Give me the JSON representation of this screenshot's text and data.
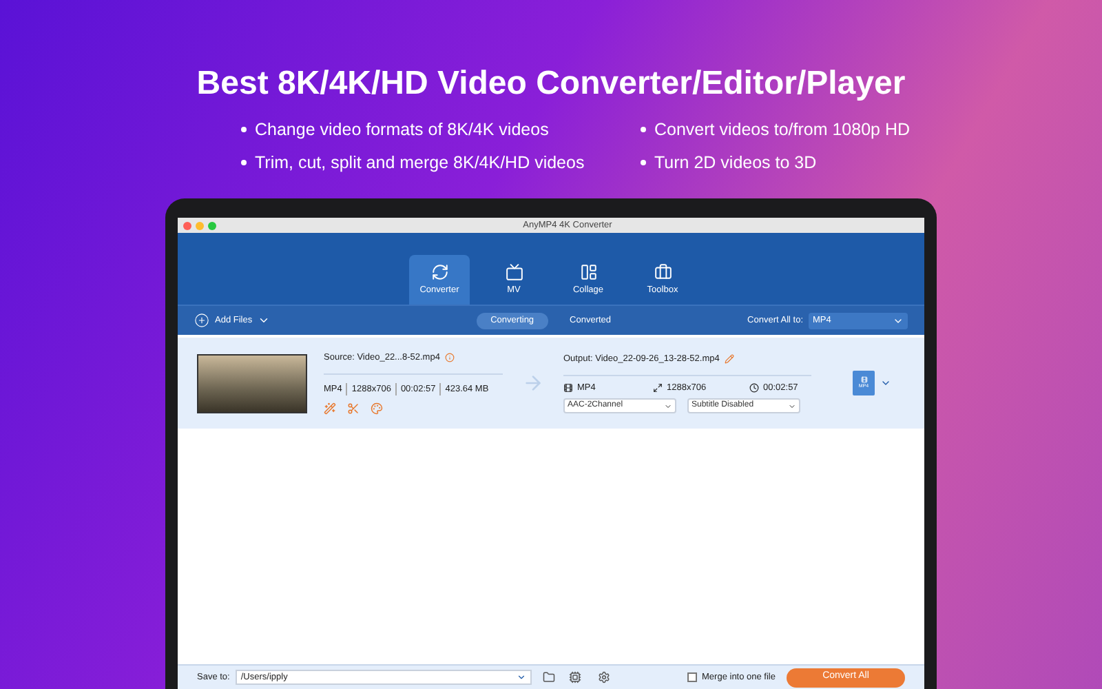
{
  "headline": "Best 8K/4K/HD Video Converter/Editor/Player",
  "features": [
    "Change video formats of 8K/4K videos",
    "Convert videos to/from 1080p HD",
    "Trim, cut, split and merge 8K/4K/HD videos",
    "Turn 2D videos to 3D"
  ],
  "window": {
    "title": "AnyMP4 4K Converter"
  },
  "tabs": [
    {
      "label": "Converter",
      "selected": true
    },
    {
      "label": "MV",
      "selected": false
    },
    {
      "label": "Collage",
      "selected": false
    },
    {
      "label": "Toolbox",
      "selected": false
    }
  ],
  "toolbar": {
    "add_files": "Add Files",
    "subtabs": [
      {
        "label": "Converting",
        "selected": true
      },
      {
        "label": "Converted",
        "selected": false
      }
    ],
    "convert_all_label": "Convert All to:",
    "convert_all_format": "MP4"
  },
  "files": [
    {
      "source": "Source: Video_22...8-52.mp4",
      "format": "MP4",
      "resolution": "1288x706",
      "duration": "00:02:57",
      "size": "423.64 MB",
      "output": "Output: Video_22-09-26_13-28-52.mp4",
      "out_format": "MP4",
      "out_resolution": "1288x706",
      "out_duration": "00:02:57",
      "audio": "AAC-2Channel",
      "subtitle": "Subtitle Disabled",
      "format_badge": "MP4"
    }
  ],
  "bottom": {
    "save_label": "Save to:",
    "path": "/Users/ipply",
    "merge": {
      "label": "Merge into one file",
      "checked": false
    },
    "convert_all": "Convert All"
  }
}
